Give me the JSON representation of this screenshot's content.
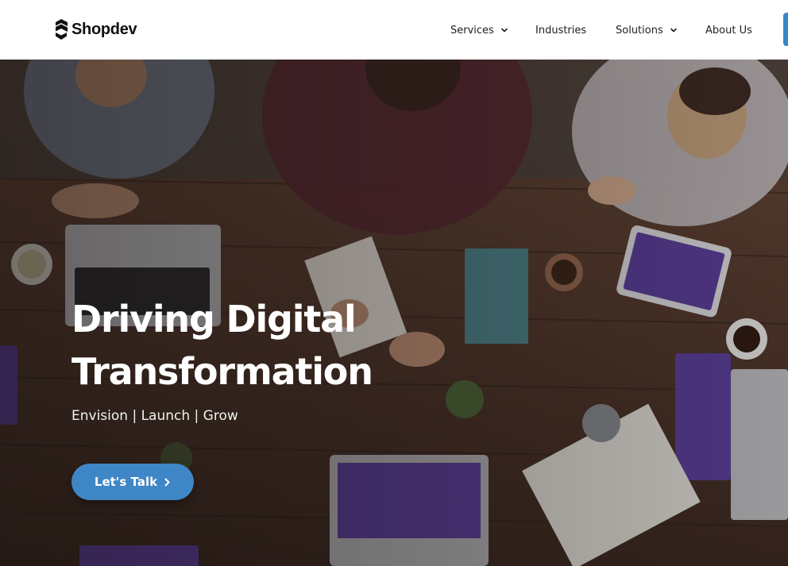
{
  "header": {
    "logo": {
      "text": "Shopdev",
      "icon": "shopdev-logo-mark"
    },
    "nav": {
      "services": {
        "label": "Services",
        "icon": "chevron-down-icon"
      },
      "industries": {
        "label": "Industries"
      },
      "solutions": {
        "label": "Solutions",
        "icon": "chevron-down-icon"
      },
      "about": {
        "label": "About Us"
      }
    }
  },
  "hero": {
    "title_line1": "Driving Digital",
    "title_line2": "Transformation",
    "subtitle": "Envision | Launch | Grow",
    "cta": {
      "label": "Let's Talk",
      "icon": "chevron-right-icon"
    }
  },
  "colors": {
    "accent": "#3f86c6",
    "header_bg": "#ffffff",
    "nav_text": "#1e1e1e",
    "hero_text": "#ffffff"
  }
}
